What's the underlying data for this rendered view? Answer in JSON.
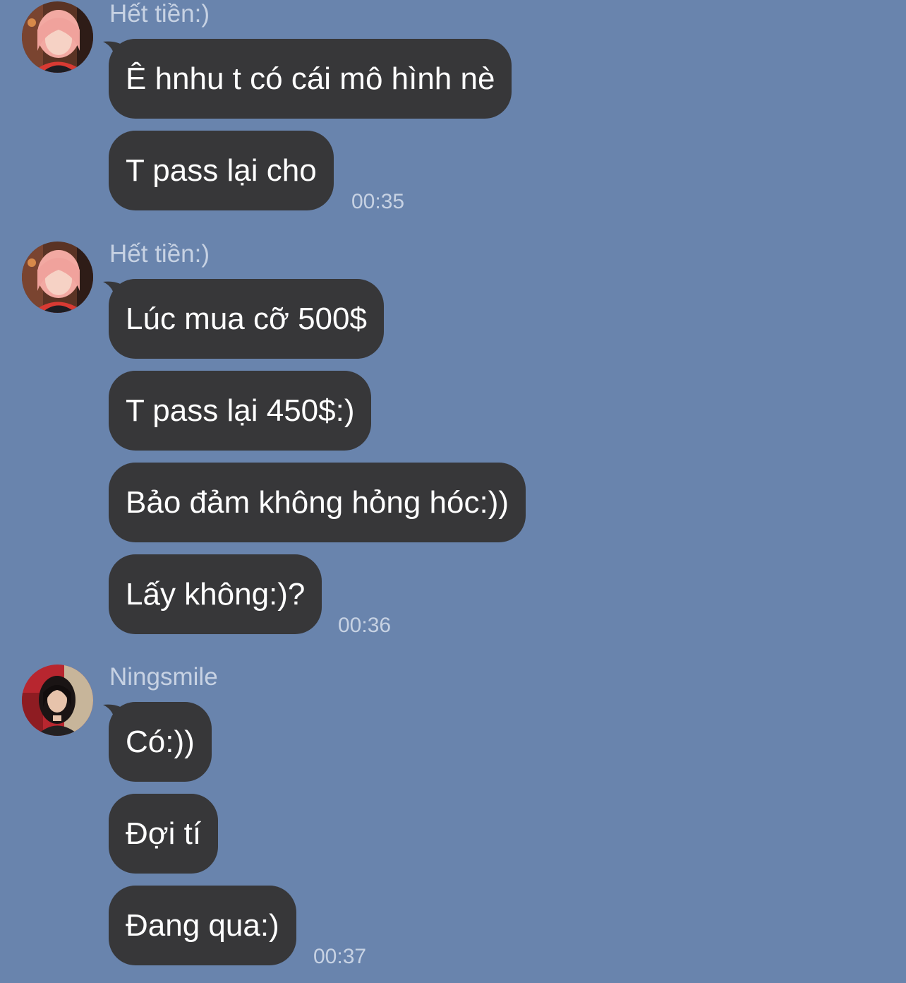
{
  "groups": [
    {
      "sender": "Hết tiền:)",
      "messages": [
        "Ê hnhu t có cái mô hình nè",
        "T pass lại cho"
      ],
      "time": "00:35"
    },
    {
      "sender": "Hết tiền:)",
      "messages": [
        "Lúc mua cỡ 500$",
        "T pass lại 450$:)",
        "Bảo đảm không hỏng hóc:))",
        "Lấy không:)?"
      ],
      "time": "00:36"
    },
    {
      "sender": "Ningsmile",
      "messages": [
        "Có:))",
        "Đợi tí",
        "Đang qua:)"
      ],
      "time": "00:37"
    }
  ],
  "colors": {
    "background": "#6984ad",
    "bubble": "#373739",
    "bubble_text": "#ffffff",
    "meta_text": "#c7d2e3"
  },
  "icons": [
    "avatar-het-tien-icon",
    "avatar-ningsmile-icon"
  ]
}
